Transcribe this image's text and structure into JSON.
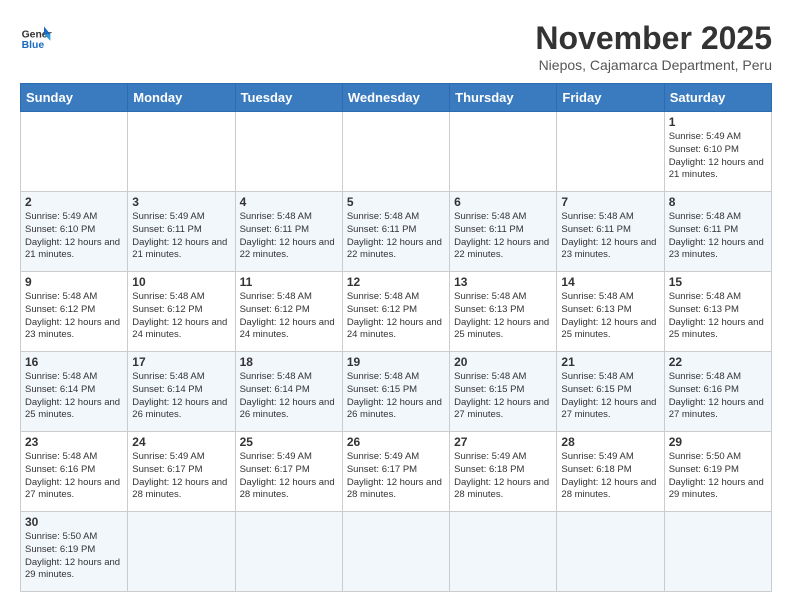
{
  "header": {
    "logo_text_general": "General",
    "logo_text_blue": "Blue",
    "month_title": "November 2025",
    "subtitle": "Niepos, Cajamarca Department, Peru"
  },
  "days_of_week": [
    "Sunday",
    "Monday",
    "Tuesday",
    "Wednesday",
    "Thursday",
    "Friday",
    "Saturday"
  ],
  "weeks": [
    [
      {
        "day": "",
        "sunrise": "",
        "sunset": "",
        "daylight": ""
      },
      {
        "day": "",
        "sunrise": "",
        "sunset": "",
        "daylight": ""
      },
      {
        "day": "",
        "sunrise": "",
        "sunset": "",
        "daylight": ""
      },
      {
        "day": "",
        "sunrise": "",
        "sunset": "",
        "daylight": ""
      },
      {
        "day": "",
        "sunrise": "",
        "sunset": "",
        "daylight": ""
      },
      {
        "day": "",
        "sunrise": "",
        "sunset": "",
        "daylight": ""
      },
      {
        "day": "1",
        "sunrise": "Sunrise: 5:49 AM",
        "sunset": "Sunset: 6:10 PM",
        "daylight": "Daylight: 12 hours and 21 minutes."
      }
    ],
    [
      {
        "day": "2",
        "sunrise": "Sunrise: 5:49 AM",
        "sunset": "Sunset: 6:10 PM",
        "daylight": "Daylight: 12 hours and 21 minutes."
      },
      {
        "day": "3",
        "sunrise": "Sunrise: 5:49 AM",
        "sunset": "Sunset: 6:11 PM",
        "daylight": "Daylight: 12 hours and 21 minutes."
      },
      {
        "day": "4",
        "sunrise": "Sunrise: 5:48 AM",
        "sunset": "Sunset: 6:11 PM",
        "daylight": "Daylight: 12 hours and 22 minutes."
      },
      {
        "day": "5",
        "sunrise": "Sunrise: 5:48 AM",
        "sunset": "Sunset: 6:11 PM",
        "daylight": "Daylight: 12 hours and 22 minutes."
      },
      {
        "day": "6",
        "sunrise": "Sunrise: 5:48 AM",
        "sunset": "Sunset: 6:11 PM",
        "daylight": "Daylight: 12 hours and 22 minutes."
      },
      {
        "day": "7",
        "sunrise": "Sunrise: 5:48 AM",
        "sunset": "Sunset: 6:11 PM",
        "daylight": "Daylight: 12 hours and 23 minutes."
      },
      {
        "day": "8",
        "sunrise": "Sunrise: 5:48 AM",
        "sunset": "Sunset: 6:11 PM",
        "daylight": "Daylight: 12 hours and 23 minutes."
      }
    ],
    [
      {
        "day": "9",
        "sunrise": "Sunrise: 5:48 AM",
        "sunset": "Sunset: 6:12 PM",
        "daylight": "Daylight: 12 hours and 23 minutes."
      },
      {
        "day": "10",
        "sunrise": "Sunrise: 5:48 AM",
        "sunset": "Sunset: 6:12 PM",
        "daylight": "Daylight: 12 hours and 24 minutes."
      },
      {
        "day": "11",
        "sunrise": "Sunrise: 5:48 AM",
        "sunset": "Sunset: 6:12 PM",
        "daylight": "Daylight: 12 hours and 24 minutes."
      },
      {
        "day": "12",
        "sunrise": "Sunrise: 5:48 AM",
        "sunset": "Sunset: 6:12 PM",
        "daylight": "Daylight: 12 hours and 24 minutes."
      },
      {
        "day": "13",
        "sunrise": "Sunrise: 5:48 AM",
        "sunset": "Sunset: 6:13 PM",
        "daylight": "Daylight: 12 hours and 25 minutes."
      },
      {
        "day": "14",
        "sunrise": "Sunrise: 5:48 AM",
        "sunset": "Sunset: 6:13 PM",
        "daylight": "Daylight: 12 hours and 25 minutes."
      },
      {
        "day": "15",
        "sunrise": "Sunrise: 5:48 AM",
        "sunset": "Sunset: 6:13 PM",
        "daylight": "Daylight: 12 hours and 25 minutes."
      }
    ],
    [
      {
        "day": "16",
        "sunrise": "Sunrise: 5:48 AM",
        "sunset": "Sunset: 6:14 PM",
        "daylight": "Daylight: 12 hours and 25 minutes."
      },
      {
        "day": "17",
        "sunrise": "Sunrise: 5:48 AM",
        "sunset": "Sunset: 6:14 PM",
        "daylight": "Daylight: 12 hours and 26 minutes."
      },
      {
        "day": "18",
        "sunrise": "Sunrise: 5:48 AM",
        "sunset": "Sunset: 6:14 PM",
        "daylight": "Daylight: 12 hours and 26 minutes."
      },
      {
        "day": "19",
        "sunrise": "Sunrise: 5:48 AM",
        "sunset": "Sunset: 6:15 PM",
        "daylight": "Daylight: 12 hours and 26 minutes."
      },
      {
        "day": "20",
        "sunrise": "Sunrise: 5:48 AM",
        "sunset": "Sunset: 6:15 PM",
        "daylight": "Daylight: 12 hours and 27 minutes."
      },
      {
        "day": "21",
        "sunrise": "Sunrise: 5:48 AM",
        "sunset": "Sunset: 6:15 PM",
        "daylight": "Daylight: 12 hours and 27 minutes."
      },
      {
        "day": "22",
        "sunrise": "Sunrise: 5:48 AM",
        "sunset": "Sunset: 6:16 PM",
        "daylight": "Daylight: 12 hours and 27 minutes."
      }
    ],
    [
      {
        "day": "23",
        "sunrise": "Sunrise: 5:48 AM",
        "sunset": "Sunset: 6:16 PM",
        "daylight": "Daylight: 12 hours and 27 minutes."
      },
      {
        "day": "24",
        "sunrise": "Sunrise: 5:49 AM",
        "sunset": "Sunset: 6:17 PM",
        "daylight": "Daylight: 12 hours and 28 minutes."
      },
      {
        "day": "25",
        "sunrise": "Sunrise: 5:49 AM",
        "sunset": "Sunset: 6:17 PM",
        "daylight": "Daylight: 12 hours and 28 minutes."
      },
      {
        "day": "26",
        "sunrise": "Sunrise: 5:49 AM",
        "sunset": "Sunset: 6:17 PM",
        "daylight": "Daylight: 12 hours and 28 minutes."
      },
      {
        "day": "27",
        "sunrise": "Sunrise: 5:49 AM",
        "sunset": "Sunset: 6:18 PM",
        "daylight": "Daylight: 12 hours and 28 minutes."
      },
      {
        "day": "28",
        "sunrise": "Sunrise: 5:49 AM",
        "sunset": "Sunset: 6:18 PM",
        "daylight": "Daylight: 12 hours and 28 minutes."
      },
      {
        "day": "29",
        "sunrise": "Sunrise: 5:50 AM",
        "sunset": "Sunset: 6:19 PM",
        "daylight": "Daylight: 12 hours and 29 minutes."
      }
    ],
    [
      {
        "day": "30",
        "sunrise": "Sunrise: 5:50 AM",
        "sunset": "Sunset: 6:19 PM",
        "daylight": "Daylight: 12 hours and 29 minutes."
      },
      {
        "day": "",
        "sunrise": "",
        "sunset": "",
        "daylight": ""
      },
      {
        "day": "",
        "sunrise": "",
        "sunset": "",
        "daylight": ""
      },
      {
        "day": "",
        "sunrise": "",
        "sunset": "",
        "daylight": ""
      },
      {
        "day": "",
        "sunrise": "",
        "sunset": "",
        "daylight": ""
      },
      {
        "day": "",
        "sunrise": "",
        "sunset": "",
        "daylight": ""
      },
      {
        "day": "",
        "sunrise": "",
        "sunset": "",
        "daylight": ""
      }
    ]
  ]
}
